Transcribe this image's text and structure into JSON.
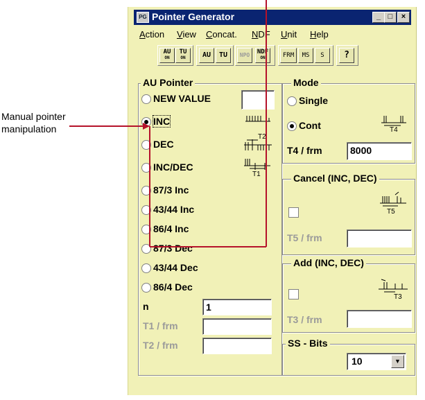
{
  "annotation": {
    "text": "Manual pointer manipulation"
  },
  "window": {
    "title": "Pointer Generator",
    "icon_text": "PG",
    "controls": {
      "minimize": "_",
      "maximize": "□",
      "close": "×"
    }
  },
  "menu": [
    "Action",
    "View",
    "Concat.",
    "NDF",
    "Unit",
    "Help"
  ],
  "toolbar": {
    "au_on": {
      "top": "AU",
      "bottom": "ON"
    },
    "tu_on": {
      "top": "TU",
      "bottom": "ON"
    },
    "au": "AU",
    "tu": "TU",
    "npo": "NPO",
    "ndf_on": {
      "top": "NDF",
      "bottom": "ON"
    },
    "frm": "FRM",
    "ms": "MS",
    "s": "S",
    "help": "?"
  },
  "au_pointer": {
    "title": "AU Pointer",
    "options": [
      "NEW VALUE",
      "INC",
      "DEC",
      "INC/DEC",
      "87/3  Inc",
      "43/44 Inc",
      "86/4  Inc",
      "87/3  Dec",
      "43/44  Dec",
      "86/4  Dec"
    ],
    "selected": "INC",
    "new_value": "",
    "n_label": "n",
    "n_value": "1",
    "t1_label": "T1 / frm",
    "t1_value": "",
    "t2_label": "T2 / frm",
    "t2_value": "",
    "diagram_labels": {
      "t2": "T2",
      "t1": "T1"
    }
  },
  "mode": {
    "title": "Mode",
    "options": [
      "Single",
      "Cont"
    ],
    "selected": "Cont",
    "t4_label": "T4 / frm",
    "t4_value": "8000",
    "diagram_label": "T4"
  },
  "cancel": {
    "title": "Cancel (INC, DEC)",
    "checked": false,
    "t5_label": "T5 / frm",
    "t5_value": "",
    "diagram_label": "T5"
  },
  "add": {
    "title": "Add (INC, DEC)",
    "checked": false,
    "t3_label": "T3 / frm",
    "t3_value": "",
    "diagram_label": "T3"
  },
  "ss_bits": {
    "title": "SS - Bits",
    "value": "10",
    "arrow": "▼"
  },
  "colors": {
    "callout": "#b5122a",
    "titlebar": "#0a2471",
    "window_bg": "#f1f1b7"
  }
}
